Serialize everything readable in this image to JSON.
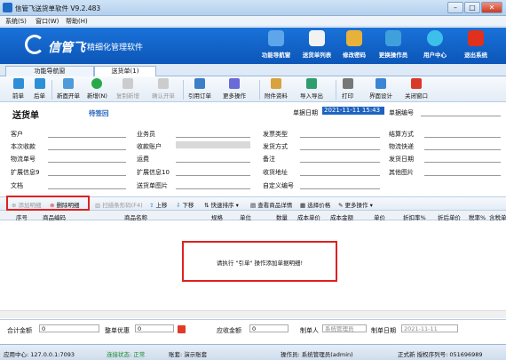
{
  "window": {
    "title": "信管飞送货单软件 V9.2.483"
  },
  "menu": [
    "系统(S)",
    "窗口(W)",
    "帮助(H)"
  ],
  "brand": {
    "logo": "信管飞",
    "slogan": "精细化管理软件"
  },
  "nav": [
    "功能导航窗",
    "送货单列表",
    "修改密码",
    "更换操作员",
    "用户中心",
    "退出系统"
  ],
  "tabs": [
    "功能导航窗",
    "送货单(1)"
  ],
  "toolbar": [
    "前单",
    "后单",
    "新面开单",
    "新增(N)",
    "复制新增",
    "确认开单",
    "引用订单",
    "更多操作",
    "附件资料",
    "导入导出",
    "打印",
    "界面设计",
    "关闭窗口"
  ],
  "form": {
    "title": "送货单",
    "status": "待签回",
    "date_label": "单据日期",
    "date_value": "2021-11-11 15:43",
    "no_label": "单据编号",
    "fields": {
      "col1": [
        "客户",
        "本次收款",
        "物流单号",
        "扩展信息9",
        "文档"
      ],
      "col2": [
        "业务员",
        "收款账户",
        "运费",
        "扩展信息10",
        "送货单图片"
      ],
      "col3": [
        "发票类型",
        "发货方式",
        "备注",
        "收货地址",
        "自定义编号"
      ],
      "col4": [
        "结算方式",
        "物流快递",
        "发货日期",
        "其他图片"
      ]
    }
  },
  "detail_toolbar": [
    "添加明细",
    "删除明细",
    "扫描条形码(F4)",
    "上移",
    "下移",
    "快速排序",
    "查看商品详情",
    "选择价格",
    "更多操作"
  ],
  "grid": {
    "columns": [
      "序号",
      "商品编码",
      "商品名称",
      "规格",
      "单位",
      "数量",
      "成本单价",
      "成本金额",
      "单价",
      "折扣率%",
      "折后单价",
      "税率%",
      "含税单"
    ],
    "message": "请执行 \"引单\" 操作添加单据明细!"
  },
  "footer": {
    "total_label": "合计金额",
    "total": "0",
    "discount_label": "整单优惠",
    "discount": "0",
    "receivable_label": "应收金额",
    "receivable": "0",
    "maker_label": "制单人",
    "maker": "系统管理员",
    "make_date_label": "制单日期",
    "make_date": "2021-11-11"
  },
  "status": {
    "app_center": "应用中心: 127.0.0.1:7093",
    "connection": "连接状态: 正常",
    "account": "账套: 演示账套",
    "operator": "操作员: 系统管理员(admin)",
    "license": "正式新  授权序列号: 051696989"
  },
  "colors": {
    "banner": "#1466cc",
    "accent_red": "#e02020"
  }
}
